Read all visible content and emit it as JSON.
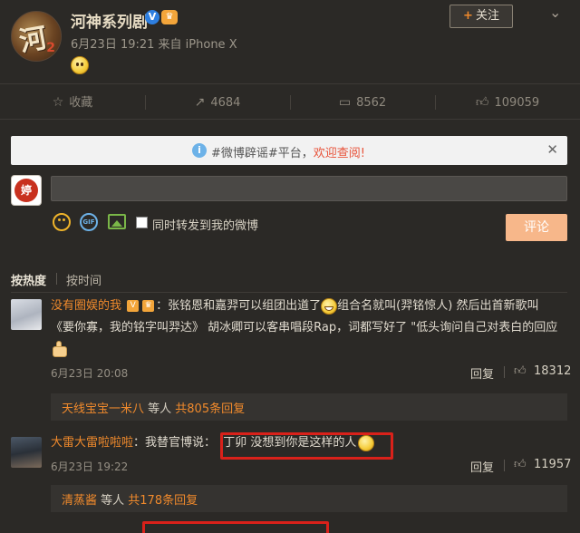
{
  "post": {
    "account_name": "河神系列剧",
    "meta": "6月23日 19:21 来自 iPhone X",
    "follow_label": "关注",
    "follow_plus": "+",
    "avatar_glyph": "河",
    "avatar_glyph2": "2"
  },
  "actions": {
    "favorite_label": "收藏",
    "repost_count": "4684",
    "comment_count": "8562",
    "like_count": "109059"
  },
  "notice": {
    "prefix": "#微博辟谣#平台，",
    "link": "欢迎查阅!"
  },
  "composer": {
    "avatar_text": "婷",
    "repost_checkbox_label": "同时转发到我的微博",
    "submit_label": "评论"
  },
  "sort": {
    "hot_label": "按热度",
    "time_label": "按时间"
  },
  "comments": [
    {
      "user": "没有圈娱的我",
      "badge": "V",
      "text_part1": "：张铭恩和嘉羿可以组团出道了",
      "text_part2": "组合名就叫(羿铭惊人) 然后出首新歌叫",
      "text_line2": "《要你寡，我的铭字叫羿达》 胡冰卿可以客串唱段Rap，词都写好了 \"低头询问自己对表白的回应",
      "time": "6月23日 20:08",
      "reply_label": "回复",
      "likes": "18312",
      "sub_user": "天线宝宝一米八",
      "sub_mid": " 等人 ",
      "sub_count": "共805条回复"
    },
    {
      "user": "大雷大雷啦啦啦",
      "text_part1": "：我替官博说：",
      "highlight": "丁卯  没想到你是这样的人",
      "time": "6月23日 19:22",
      "reply_label": "回复",
      "likes": "11957",
      "sub_user": "清蒸酱",
      "sub_mid": " 等人 ",
      "sub_count": "共178条回复"
    }
  ],
  "accent_colors": {
    "orange": "#f08a2c",
    "highlight_red": "#d9211a",
    "notice_link": "#e8533a"
  }
}
